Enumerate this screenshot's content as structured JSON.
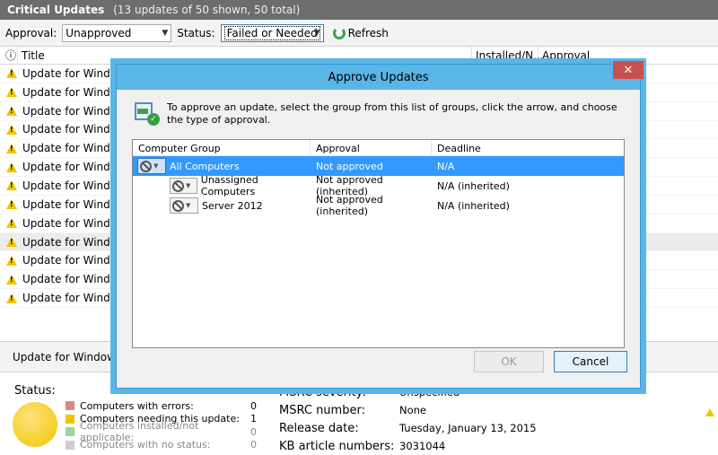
{
  "header": {
    "title": "Critical Updates",
    "subtitle": "(13 updates of 50 shown, 50 total)"
  },
  "filters": {
    "approval_label": "Approval:",
    "approval_value": "Unapproved",
    "status_label": "Status:",
    "status_value": "Failed or Needed",
    "refresh_label": "Refresh"
  },
  "grid": {
    "columns": [
      "Title",
      "Installed/N...",
      "Approval"
    ],
    "info_icon": "ⓘ",
    "rows": [
      "Update for Windows",
      "Update for Windows",
      "Update for Windows",
      "Update for Windows",
      "Update for Windows",
      "Update for Windows",
      "Update for Windows",
      "Update for Windows",
      "Update for Windows",
      "Update for Windows",
      "Update for Windows",
      "Update for Windows",
      "Update for Windows"
    ]
  },
  "details": {
    "title": "Update for Windows Se",
    "status_label": "Status:",
    "legend": [
      {
        "label": "Computers with errors:",
        "count": "0",
        "color": "#d98a8a"
      },
      {
        "label": "Computers needing this update:",
        "count": "1",
        "color": "#f2c400"
      },
      {
        "label": "Computers installed/not applicable:",
        "count": "0",
        "color": "#9ed39e"
      },
      {
        "label": "Computers with no status:",
        "count": "0",
        "color": "#cfcfcf"
      }
    ],
    "meta": [
      {
        "key": "MSRC severity:",
        "value": "Unspecified"
      },
      {
        "key": "MSRC number:",
        "value": "None"
      },
      {
        "key": "Release date:",
        "value": "Tuesday, January 13, 2015"
      },
      {
        "key": "KB article numbers:",
        "value": "3031044"
      }
    ]
  },
  "dialog": {
    "title": "Approve Updates",
    "close": "✕",
    "instructions": "To approve an update, select the group from this list of groups, click the arrow, and choose the type of approval.",
    "columns": [
      "Computer Group",
      "Approval",
      "Deadline"
    ],
    "groups": [
      {
        "name": "All Computers",
        "approval": "Not approved",
        "deadline": "N/A"
      },
      {
        "name": "Unassigned Computers",
        "approval": "Not approved (inherited)",
        "deadline": "N/A (inherited)"
      },
      {
        "name": "Server 2012",
        "approval": "Not approved (inherited)",
        "deadline": "N/A (inherited)"
      }
    ],
    "ok_label": "OK",
    "cancel_label": "Cancel"
  }
}
